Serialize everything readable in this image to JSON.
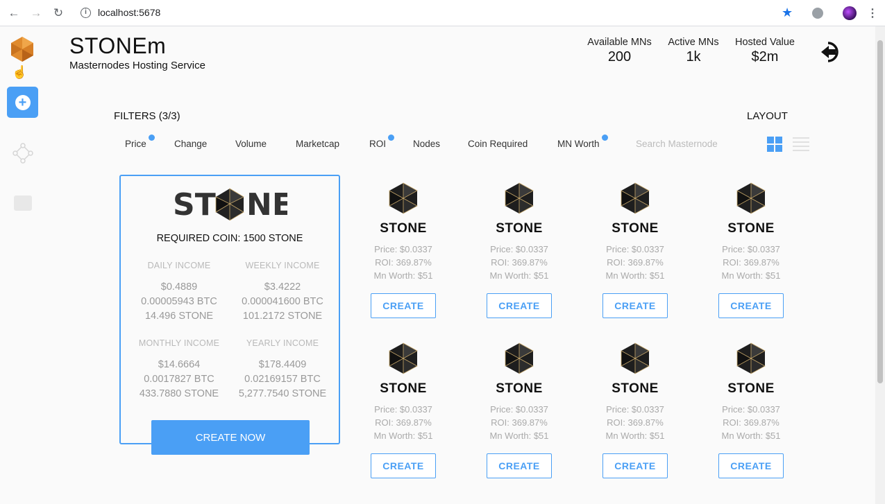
{
  "browser": {
    "url": "localhost:5678"
  },
  "header": {
    "title": "STONEm",
    "subtitle": "Masternodes Hosting Service",
    "stats": [
      {
        "label": "Available MNs",
        "value": "200"
      },
      {
        "label": "Active MNs",
        "value": "1k"
      },
      {
        "label": "Hosted Value",
        "value": "$2m"
      }
    ]
  },
  "filters": {
    "title": "FILTERS (3/3)",
    "layout_title": "LAYOUT",
    "items": [
      {
        "label": "Price",
        "active": true
      },
      {
        "label": "Change",
        "active": false
      },
      {
        "label": "Volume",
        "active": false
      },
      {
        "label": "Marketcap",
        "active": false
      },
      {
        "label": "ROI",
        "active": true
      },
      {
        "label": "Nodes",
        "active": false
      },
      {
        "label": "Coin Required",
        "active": false
      },
      {
        "label": "MN Worth",
        "active": true
      }
    ],
    "search_placeholder": "Search Masternode"
  },
  "featured": {
    "logo_text": "STONE",
    "required": "REQUIRED COIN: 1500 STONE",
    "daily": {
      "label": "DAILY INCOME",
      "usd": "$0.4889",
      "btc": "0.00005943 BTC",
      "coin": "14.496 STONE"
    },
    "weekly": {
      "label": "WEEKLY INCOME",
      "usd": "$3.4222",
      "btc": "0.000041600 BTC",
      "coin": "101.2172 STONE"
    },
    "monthly": {
      "label": "MONTHLY INCOME",
      "usd": "$14.6664",
      "btc": "0.0017827 BTC",
      "coin": "433.7880 STONE"
    },
    "yearly": {
      "label": "YEARLY INCOME",
      "usd": "$178.4409",
      "btc": "0.02169157 BTC",
      "coin": "5,277.7540 STONE"
    },
    "button": "CREATE NOW"
  },
  "cards": [
    {
      "name": "STONE",
      "price": "Price: $0.0337",
      "roi": "ROI: 369.87%",
      "worth": "Mn Worth: $51",
      "button": "CREATE"
    },
    {
      "name": "STONE",
      "price": "Price: $0.0337",
      "roi": "ROI: 369.87%",
      "worth": "Mn Worth: $51",
      "button": "CREATE"
    },
    {
      "name": "STONE",
      "price": "Price: $0.0337",
      "roi": "ROI: 369.87%",
      "worth": "Mn Worth: $51",
      "button": "CREATE"
    },
    {
      "name": "STONE",
      "price": "Price: $0.0337",
      "roi": "ROI: 369.87%",
      "worth": "Mn Worth: $51",
      "button": "CREATE"
    },
    {
      "name": "STONE",
      "price": "Price: $0.0337",
      "roi": "ROI: 369.87%",
      "worth": "Mn Worth: $51",
      "button": "CREATE"
    },
    {
      "name": "STONE",
      "price": "Price: $0.0337",
      "roi": "ROI: 369.87%",
      "worth": "Mn Worth: $51",
      "button": "CREATE"
    },
    {
      "name": "STONE",
      "price": "Price: $0.0337",
      "roi": "ROI: 369.87%",
      "worth": "Mn Worth: $51",
      "button": "CREATE"
    },
    {
      "name": "STONE",
      "price": "Price: $0.0337",
      "roi": "ROI: 369.87%",
      "worth": "Mn Worth: $51",
      "button": "CREATE"
    }
  ],
  "colors": {
    "accent": "#4a9ff5",
    "logo_orange": "#e08b2e"
  }
}
